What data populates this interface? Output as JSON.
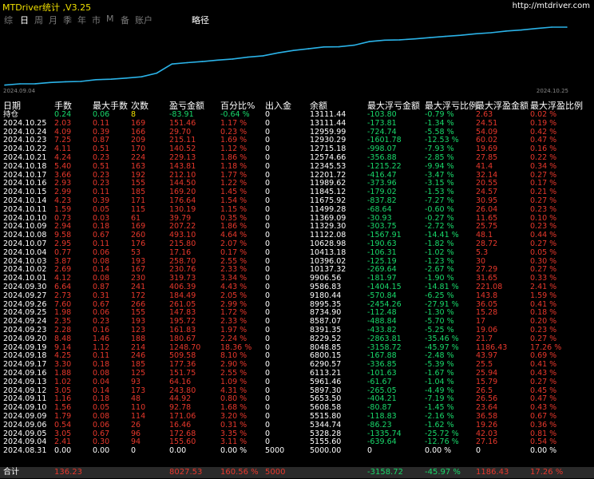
{
  "header": {
    "title": "MTDriver统计 ,V3.25",
    "url": "http://mtdriver.com"
  },
  "tabs": [
    {
      "label": "综",
      "active": false
    },
    {
      "label": "日",
      "active": true
    },
    {
      "label": "周",
      "active": false
    },
    {
      "label": "月",
      "active": false
    },
    {
      "label": "季",
      "active": false
    },
    {
      "label": "年",
      "active": false
    },
    {
      "label": "市",
      "active": false
    },
    {
      "label": "M",
      "active": false
    },
    {
      "label": "备",
      "active": false
    },
    {
      "label": "账户",
      "active": false
    },
    {
      "label": "略径",
      "active": true
    }
  ],
  "chart_data": {
    "type": "line",
    "x": [
      "2024.09.04",
      "2024.09.05",
      "2024.09.06",
      "2024.09.09",
      "2024.09.10",
      "2024.09.11",
      "2024.09.12",
      "2024.09.13",
      "2024.09.16",
      "2024.09.17",
      "2024.09.18",
      "2024.09.19",
      "2024.09.20",
      "2024.09.23",
      "2024.09.24",
      "2024.09.25",
      "2024.09.26",
      "2024.09.27",
      "2024.09.30",
      "2024.10.01",
      "2024.10.02",
      "2024.10.03",
      "2024.10.04",
      "2024.10.07",
      "2024.10.08",
      "2024.10.09",
      "2024.10.10",
      "2024.10.11",
      "2024.10.14",
      "2024.10.15",
      "2024.10.16",
      "2024.10.17",
      "2024.10.18",
      "2024.10.21",
      "2024.10.22",
      "2024.10.23",
      "2024.10.24",
      "2024.10.25"
    ],
    "values": [
      5155.6,
      5328.28,
      5344.74,
      5515.8,
      5608.58,
      5653.5,
      5897.3,
      5961.46,
      6113.21,
      6290.57,
      6800.15,
      8048.85,
      8229.52,
      8391.35,
      8587.07,
      8734.9,
      8995.35,
      9180.44,
      9586.83,
      9906.56,
      10137.32,
      10396.02,
      10413.18,
      10628.98,
      11122.08,
      11329.3,
      11369.09,
      11499.28,
      11675.92,
      11845.12,
      11989.62,
      12201.72,
      12345.53,
      12574.66,
      12715.18,
      12930.29,
      13111.44,
      13111.44
    ],
    "x_start_label": "2024.09.04",
    "x_end_label": "2024.10.25",
    "line_color": "#2bb3e8"
  },
  "table": {
    "headers": [
      "日期",
      "手数",
      "最大手数",
      "次数",
      "盈亏金额",
      "百分比%",
      "出入金",
      "余额",
      "最大浮亏金额",
      "最大浮亏比例",
      "最大浮盈金额",
      "最大浮盈比例"
    ],
    "rows": [
      {
        "date": "持仓",
        "lots": "0.24",
        "maxlots": "0.06",
        "count": "8",
        "pl": "-83.91",
        "pct": "-0.64 %",
        "dep": "0",
        "bal": "13111.44",
        "maxdd": "-103.80",
        "maxddpct": "-0.79 %",
        "maxfp": "2.63",
        "maxfppct": "0.02 %",
        "kind": "open"
      },
      {
        "date": "2024.10.25",
        "lots": "2.03",
        "maxlots": "0.11",
        "count": "169",
        "pl": "151.46",
        "pct": "1.17 %",
        "dep": "0",
        "bal": "13111.44",
        "maxdd": "-173.81",
        "maxddpct": "-1.34 %",
        "maxfp": "24.51",
        "maxfppct": "0.19 %",
        "kind": "pos"
      },
      {
        "date": "2024.10.24",
        "lots": "4.09",
        "maxlots": "0.39",
        "count": "166",
        "pl": "29.70",
        "pct": "0.23 %",
        "dep": "0",
        "bal": "12959.99",
        "maxdd": "-724.74",
        "maxddpct": "-5.58 %",
        "maxfp": "54.09",
        "maxfppct": "0.42 %",
        "kind": "pos"
      },
      {
        "date": "2024.10.23",
        "lots": "7.25",
        "maxlots": "0.87",
        "count": "209",
        "pl": "215.11",
        "pct": "1.69 %",
        "dep": "0",
        "bal": "12930.29",
        "maxdd": "-1601.78",
        "maxddpct": "-12.53 %",
        "maxfp": "60.02",
        "maxfppct": "0.47 %",
        "kind": "pos"
      },
      {
        "date": "2024.10.22",
        "lots": "4.11",
        "maxlots": "0.51",
        "count": "170",
        "pl": "140.52",
        "pct": "1.12 %",
        "dep": "0",
        "bal": "12715.18",
        "maxdd": "-998.07",
        "maxddpct": "-7.93 %",
        "maxfp": "19.69",
        "maxfppct": "0.16 %",
        "kind": "pos"
      },
      {
        "date": "2024.10.21",
        "lots": "4.24",
        "maxlots": "0.23",
        "count": "224",
        "pl": "229.13",
        "pct": "1.86 %",
        "dep": "0",
        "bal": "12574.66",
        "maxdd": "-356.88",
        "maxddpct": "-2.85 %",
        "maxfp": "27.85",
        "maxfppct": "0.22 %",
        "kind": "pos"
      },
      {
        "date": "2024.10.18",
        "lots": "5.40",
        "maxlots": "0.51",
        "count": "163",
        "pl": "143.81",
        "pct": "1.18 %",
        "dep": "0",
        "bal": "12345.53",
        "maxdd": "-1215.22",
        "maxddpct": "-9.94 %",
        "maxfp": "41.4",
        "maxfppct": "0.34 %",
        "kind": "pos"
      },
      {
        "date": "2024.10.17",
        "lots": "3.66",
        "maxlots": "0.23",
        "count": "192",
        "pl": "212.10",
        "pct": "1.77 %",
        "dep": "0",
        "bal": "12201.72",
        "maxdd": "-416.47",
        "maxddpct": "-3.47 %",
        "maxfp": "32.14",
        "maxfppct": "0.27 %",
        "kind": "pos"
      },
      {
        "date": "2024.10.16",
        "lots": "2.93",
        "maxlots": "0.23",
        "count": "155",
        "pl": "144.50",
        "pct": "1.22 %",
        "dep": "0",
        "bal": "11989.62",
        "maxdd": "-373.96",
        "maxddpct": "-3.15 %",
        "maxfp": "20.55",
        "maxfppct": "0.17 %",
        "kind": "pos"
      },
      {
        "date": "2024.10.15",
        "lots": "2.99",
        "maxlots": "0.11",
        "count": "185",
        "pl": "169.20",
        "pct": "1.45 %",
        "dep": "0",
        "bal": "11845.12",
        "maxdd": "-179.02",
        "maxddpct": "-1.53 %",
        "maxfp": "24.57",
        "maxfppct": "0.21 %",
        "kind": "pos"
      },
      {
        "date": "2024.10.14",
        "lots": "4.23",
        "maxlots": "0.39",
        "count": "171",
        "pl": "176.64",
        "pct": "1.54 %",
        "dep": "0",
        "bal": "11675.92",
        "maxdd": "-837.82",
        "maxddpct": "-7.27 %",
        "maxfp": "30.95",
        "maxfppct": "0.27 %",
        "kind": "pos"
      },
      {
        "date": "2024.10.11",
        "lots": "1.59",
        "maxlots": "0.05",
        "count": "115",
        "pl": "130.19",
        "pct": "1.15 %",
        "dep": "0",
        "bal": "11499.28",
        "maxdd": "-68.64",
        "maxddpct": "-0.60 %",
        "maxfp": "26.04",
        "maxfppct": "0.23 %",
        "kind": "pos"
      },
      {
        "date": "2024.10.10",
        "lots": "0.73",
        "maxlots": "0.03",
        "count": "61",
        "pl": "39.79",
        "pct": "0.35 %",
        "dep": "0",
        "bal": "11369.09",
        "maxdd": "-30.93",
        "maxddpct": "-0.27 %",
        "maxfp": "11.65",
        "maxfppct": "0.10 %",
        "kind": "pos"
      },
      {
        "date": "2024.10.09",
        "lots": "2.94",
        "maxlots": "0.18",
        "count": "169",
        "pl": "207.22",
        "pct": "1.86 %",
        "dep": "0",
        "bal": "11329.30",
        "maxdd": "-303.75",
        "maxddpct": "-2.72 %",
        "maxfp": "25.75",
        "maxfppct": "0.23 %",
        "kind": "pos"
      },
      {
        "date": "2024.10.08",
        "lots": "9.58",
        "maxlots": "0.67",
        "count": "260",
        "pl": "493.10",
        "pct": "4.64 %",
        "dep": "0",
        "bal": "11122.08",
        "maxdd": "-1567.91",
        "maxddpct": "-14.41 %",
        "maxfp": "48.1",
        "maxfppct": "0.44 %",
        "kind": "pos"
      },
      {
        "date": "2024.10.07",
        "lots": "2.95",
        "maxlots": "0.11",
        "count": "176",
        "pl": "215.80",
        "pct": "2.07 %",
        "dep": "0",
        "bal": "10628.98",
        "maxdd": "-190.63",
        "maxddpct": "-1.82 %",
        "maxfp": "28.72",
        "maxfppct": "0.27 %",
        "kind": "pos"
      },
      {
        "date": "2024.10.04",
        "lots": "0.77",
        "maxlots": "0.06",
        "count": "53",
        "pl": "17.16",
        "pct": "0.17 %",
        "dep": "0",
        "bal": "10413.18",
        "maxdd": "-106.31",
        "maxddpct": "-1.02 %",
        "maxfp": "5.3",
        "maxfppct": "0.05 %",
        "kind": "pos"
      },
      {
        "date": "2024.10.03",
        "lots": "3.87",
        "maxlots": "0.08",
        "count": "193",
        "pl": "258.70",
        "pct": "2.55 %",
        "dep": "0",
        "bal": "10396.02",
        "maxdd": "-125.19",
        "maxddpct": "-1.23 %",
        "maxfp": "30",
        "maxfppct": "0.30 %",
        "kind": "pos"
      },
      {
        "date": "2024.10.02",
        "lots": "2.69",
        "maxlots": "0.14",
        "count": "167",
        "pl": "230.76",
        "pct": "2.33 %",
        "dep": "0",
        "bal": "10137.32",
        "maxdd": "-269.64",
        "maxddpct": "-2.67 %",
        "maxfp": "27.29",
        "maxfppct": "0.27 %",
        "kind": "pos"
      },
      {
        "date": "2024.10.01",
        "lots": "4.12",
        "maxlots": "0.08",
        "count": "230",
        "pl": "319.73",
        "pct": "3.34 %",
        "dep": "0",
        "bal": "9906.56",
        "maxdd": "-181.97",
        "maxddpct": "-1.90 %",
        "maxfp": "31.65",
        "maxfppct": "0.33 %",
        "kind": "pos"
      },
      {
        "date": "2024.09.30",
        "lots": "6.64",
        "maxlots": "0.87",
        "count": "241",
        "pl": "406.39",
        "pct": "4.43 %",
        "dep": "0",
        "bal": "9586.83",
        "maxdd": "-1404.15",
        "maxddpct": "-14.81 %",
        "maxfp": "221.08",
        "maxfppct": "2.41 %",
        "kind": "pos"
      },
      {
        "date": "2024.09.27",
        "lots": "2.73",
        "maxlots": "0.31",
        "count": "172",
        "pl": "184.49",
        "pct": "2.05 %",
        "dep": "0",
        "bal": "9180.44",
        "maxdd": "-570.84",
        "maxddpct": "-6.25 %",
        "maxfp": "143.8",
        "maxfppct": "1.59 %",
        "kind": "pos"
      },
      {
        "date": "2024.09.26",
        "lots": "7.60",
        "maxlots": "0.67",
        "count": "266",
        "pl": "261.05",
        "pct": "2.99 %",
        "dep": "0",
        "bal": "8995.35",
        "maxdd": "-2454.26",
        "maxddpct": "-27.91 %",
        "maxfp": "36.05",
        "maxfppct": "0.41 %",
        "kind": "pos"
      },
      {
        "date": "2024.09.25",
        "lots": "1.98",
        "maxlots": "0.06",
        "count": "155",
        "pl": "147.83",
        "pct": "1.72 %",
        "dep": "0",
        "bal": "8734.90",
        "maxdd": "-112.48",
        "maxddpct": "-1.30 %",
        "maxfp": "15.28",
        "maxfppct": "0.18 %",
        "kind": "pos"
      },
      {
        "date": "2024.09.24",
        "lots": "2.35",
        "maxlots": "0.23",
        "count": "193",
        "pl": "195.72",
        "pct": "2.33 %",
        "dep": "0",
        "bal": "8587.07",
        "maxdd": "-488.84",
        "maxddpct": "-5.70 %",
        "maxfp": "17",
        "maxfppct": "0.20 %",
        "kind": "pos"
      },
      {
        "date": "2024.09.23",
        "lots": "2.28",
        "maxlots": "0.16",
        "count": "123",
        "pl": "161.83",
        "pct": "1.97 %",
        "dep": "0",
        "bal": "8391.35",
        "maxdd": "-433.82",
        "maxddpct": "-5.25 %",
        "maxfp": "19.06",
        "maxfppct": "0.23 %",
        "kind": "pos"
      },
      {
        "date": "2024.09.20",
        "lots": "8.48",
        "maxlots": "1.46",
        "count": "188",
        "pl": "180.67",
        "pct": "2.24 %",
        "dep": "0",
        "bal": "8229.52",
        "maxdd": "-2863.81",
        "maxddpct": "-35.46 %",
        "maxfp": "21.7",
        "maxfppct": "0.27 %",
        "kind": "pos"
      },
      {
        "date": "2024.09.19",
        "lots": "9.14",
        "maxlots": "1.12",
        "count": "214",
        "pl": "1248.70",
        "pct": "18.36 %",
        "dep": "0",
        "bal": "8048.85",
        "maxdd": "-3158.72",
        "maxddpct": "-45.97 %",
        "maxfp": "1186.43",
        "maxfppct": "17.26 %",
        "kind": "pos"
      },
      {
        "date": "2024.09.18",
        "lots": "4.25",
        "maxlots": "0.11",
        "count": "246",
        "pl": "509.58",
        "pct": "8.10 %",
        "dep": "0",
        "bal": "6800.15",
        "maxdd": "-167.88",
        "maxddpct": "-2.48 %",
        "maxfp": "43.97",
        "maxfppct": "0.69 %",
        "kind": "pos"
      },
      {
        "date": "2024.09.17",
        "lots": "3.30",
        "maxlots": "0.18",
        "count": "185",
        "pl": "177.36",
        "pct": "2.90 %",
        "dep": "0",
        "bal": "6290.57",
        "maxdd": "-336.85",
        "maxddpct": "-5.39 %",
        "maxfp": "25.5",
        "maxfppct": "0.41 %",
        "kind": "pos"
      },
      {
        "date": "2024.09.16",
        "lots": "1.88",
        "maxlots": "0.08",
        "count": "125",
        "pl": "151.75",
        "pct": "2.55 %",
        "dep": "0",
        "bal": "6113.21",
        "maxdd": "-101.63",
        "maxddpct": "-1.67 %",
        "maxfp": "25.94",
        "maxfppct": "0.43 %",
        "kind": "pos"
      },
      {
        "date": "2024.09.13",
        "lots": "1.02",
        "maxlots": "0.04",
        "count": "93",
        "pl": "64.16",
        "pct": "1.09 %",
        "dep": "0",
        "bal": "5961.46",
        "maxdd": "-61.67",
        "maxddpct": "-1.04 %",
        "maxfp": "15.79",
        "maxfppct": "0.27 %",
        "kind": "pos"
      },
      {
        "date": "2024.09.12",
        "lots": "3.05",
        "maxlots": "0.14",
        "count": "173",
        "pl": "243.80",
        "pct": "4.31 %",
        "dep": "0",
        "bal": "5897.30",
        "maxdd": "-265.05",
        "maxddpct": "-4.49 %",
        "maxfp": "26.5",
        "maxfppct": "0.45 %",
        "kind": "pos"
      },
      {
        "date": "2024.09.11",
        "lots": "1.16",
        "maxlots": "0.18",
        "count": "48",
        "pl": "44.92",
        "pct": "0.80 %",
        "dep": "0",
        "bal": "5653.50",
        "maxdd": "-404.21",
        "maxddpct": "-7.19 %",
        "maxfp": "26.56",
        "maxfppct": "0.47 %",
        "kind": "pos"
      },
      {
        "date": "2024.09.10",
        "lots": "1.56",
        "maxlots": "0.05",
        "count": "110",
        "pl": "92.78",
        "pct": "1.68 %",
        "dep": "0",
        "bal": "5608.58",
        "maxdd": "-80.87",
        "maxddpct": "-1.45 %",
        "maxfp": "23.64",
        "maxfppct": "0.43 %",
        "kind": "pos"
      },
      {
        "date": "2024.09.09",
        "lots": "1.79",
        "maxlots": "0.08",
        "count": "114",
        "pl": "171.06",
        "pct": "3.20 %",
        "dep": "0",
        "bal": "5515.80",
        "maxdd": "-118.83",
        "maxddpct": "-2.16 %",
        "maxfp": "36.58",
        "maxfppct": "0.67 %",
        "kind": "pos"
      },
      {
        "date": "2024.09.06",
        "lots": "0.54",
        "maxlots": "0.06",
        "count": "26",
        "pl": "16.46",
        "pct": "0.31 %",
        "dep": "0",
        "bal": "5344.74",
        "maxdd": "-86.23",
        "maxddpct": "-1.62 %",
        "maxfp": "19.26",
        "maxfppct": "0.36 %",
        "kind": "pos"
      },
      {
        "date": "2024.09.05",
        "lots": "3.05",
        "maxlots": "0.67",
        "count": "96",
        "pl": "172.68",
        "pct": "3.35 %",
        "dep": "0",
        "bal": "5328.28",
        "maxdd": "-1335.74",
        "maxddpct": "-25.72 %",
        "maxfp": "42.03",
        "maxfppct": "0.81 %",
        "kind": "pos"
      },
      {
        "date": "2024.09.04",
        "lots": "2.41",
        "maxlots": "0.30",
        "count": "94",
        "pl": "155.60",
        "pct": "3.11 %",
        "dep": "0",
        "bal": "5155.60",
        "maxdd": "-639.64",
        "maxddpct": "-12.76 %",
        "maxfp": "27.16",
        "maxfppct": "0.54 %",
        "kind": "pos"
      },
      {
        "date": "2024.08.31",
        "lots": "0.00",
        "maxlots": "0.00",
        "count": "0",
        "pl": "0.00",
        "pct": "0.00 %",
        "dep": "5000",
        "bal": "5000.00",
        "maxdd": "0",
        "maxddpct": "0.00 %",
        "maxfp": "0",
        "maxfppct": "0.00 %",
        "kind": "zero"
      }
    ],
    "total": {
      "label": "合计",
      "lots": "136.23",
      "maxlots": "",
      "count": "",
      "pl": "8027.53",
      "pct": "160.56 %",
      "dep": "5000",
      "bal": "",
      "maxdd": "-3158.72",
      "maxddpct": "-45.97 %",
      "maxfp": "1186.43",
      "maxfppct": "17.26 %"
    }
  },
  "colors": {
    "profit": "#e8382c",
    "loss": "#19d96b",
    "title": "#f0e000",
    "line": "#2bb3e8",
    "background": "#000000"
  }
}
